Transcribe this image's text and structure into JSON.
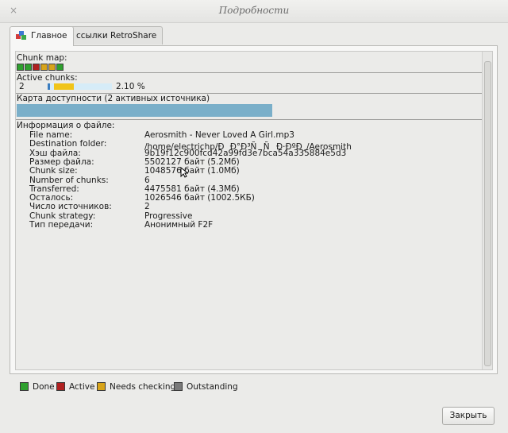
{
  "window": {
    "title": "Подробности",
    "close_glyph": "×"
  },
  "tabs": [
    {
      "label": "Главное",
      "active": true,
      "icon": "colored-cubes-icon"
    },
    {
      "label": "ссылки RetroShare",
      "active": false
    }
  ],
  "chunk_map": {
    "label": "Chunk map:",
    "chunks": [
      "done",
      "done",
      "active",
      "needs-checking",
      "needs-checking",
      "done"
    ]
  },
  "active_chunks": {
    "label": "Active chunks:",
    "count": "2",
    "progress_percent": 2.1,
    "progress_text": "2.10 %"
  },
  "availability": {
    "label": "Карта доступности (2 активных источника)",
    "fill_fraction": 1.0
  },
  "file_info": {
    "label": "Информация о файле:",
    "rows": [
      {
        "k": "File name:",
        "v": "Aerosmith - Never Loved A Girl.mp3"
      },
      {
        "k": "Destination folder:",
        "v": "/home/electrichp/ÐÐ°Ð³ÑÑÐ·ÐºÐ¸/Aerosmith"
      },
      {
        "k": "Хэш файла:",
        "v": "9b19f12c900fcd42a99fd3e7bca54a335884e5d3"
      },
      {
        "k": "Размер файла:",
        "v": "5502127 байт (5.2Мб)"
      },
      {
        "k": "Chunk size:",
        "v": "1048576 байт (1.0Мб)"
      },
      {
        "k": "Number of chunks:",
        "v": "6"
      },
      {
        "k": "Transferred:",
        "v": "4475581 байт (4.3Мб)"
      },
      {
        "k": "Осталось:",
        "v": "1026546 байт (1002.5КБ)"
      },
      {
        "k": "Число источников:",
        "v": "2"
      },
      {
        "k": "Chunk strategy:",
        "v": "Progressive"
      },
      {
        "k": "Тип передачи:",
        "v": "Анонимный F2F"
      }
    ]
  },
  "legend": [
    {
      "label": "Done",
      "color": "#2ea02e"
    },
    {
      "label": "Active",
      "color": "#b02020"
    },
    {
      "label": "Needs checking",
      "color": "#d8a41a"
    },
    {
      "label": "Outstanding",
      "color": "#7a7a7a"
    }
  ],
  "colors": {
    "done": "#2ea02e",
    "active": "#b02020",
    "needs-checking": "#d8a41a",
    "outstanding": "#7a7a7a",
    "progress_fill": "#f0c419",
    "progress_track": "#d6ecf8",
    "availability_fill": "#7aafc9"
  },
  "buttons": {
    "close_label": "Закрыть"
  }
}
